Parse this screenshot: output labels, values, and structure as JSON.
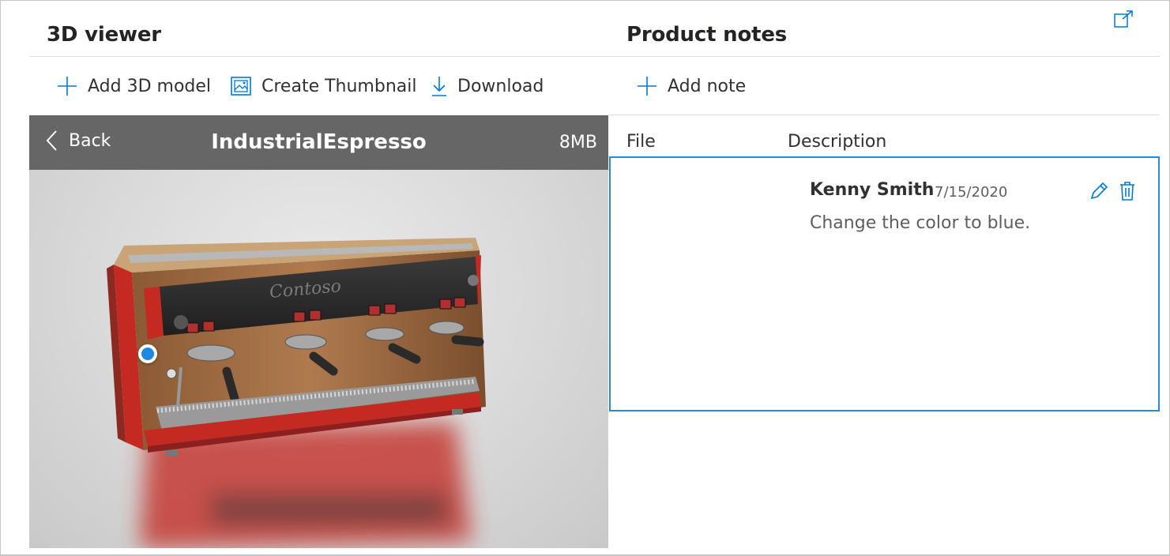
{
  "viewer": {
    "title": "3D viewer",
    "toolbar": {
      "add_model_label": "Add 3D model",
      "thumbnail_label": "Create Thumbnail",
      "download_label": "Download"
    },
    "model": {
      "back_label": "Back",
      "name": "IndustrialEspresso",
      "size": "8MB",
      "brand_text": "Contoso"
    }
  },
  "notes": {
    "title": "Product notes",
    "add_note_label": "Add note",
    "columns": [
      "File",
      "Description"
    ],
    "items": [
      {
        "author": "Kenny Smith",
        "date": "7/15/2020",
        "text": "Change the color to blue."
      }
    ]
  },
  "icons": {
    "expand": "expand-icon",
    "add": "plus-icon",
    "thumbnail": "image-icon",
    "download": "download-icon",
    "back": "chevron-left-icon",
    "edit": "pencil-icon",
    "delete": "trash-icon"
  },
  "colors": {
    "accent": "#0078d4",
    "selection_border": "#2b88d8",
    "viewer_bar": "#666666",
    "hotspot": "#1e88e5"
  }
}
